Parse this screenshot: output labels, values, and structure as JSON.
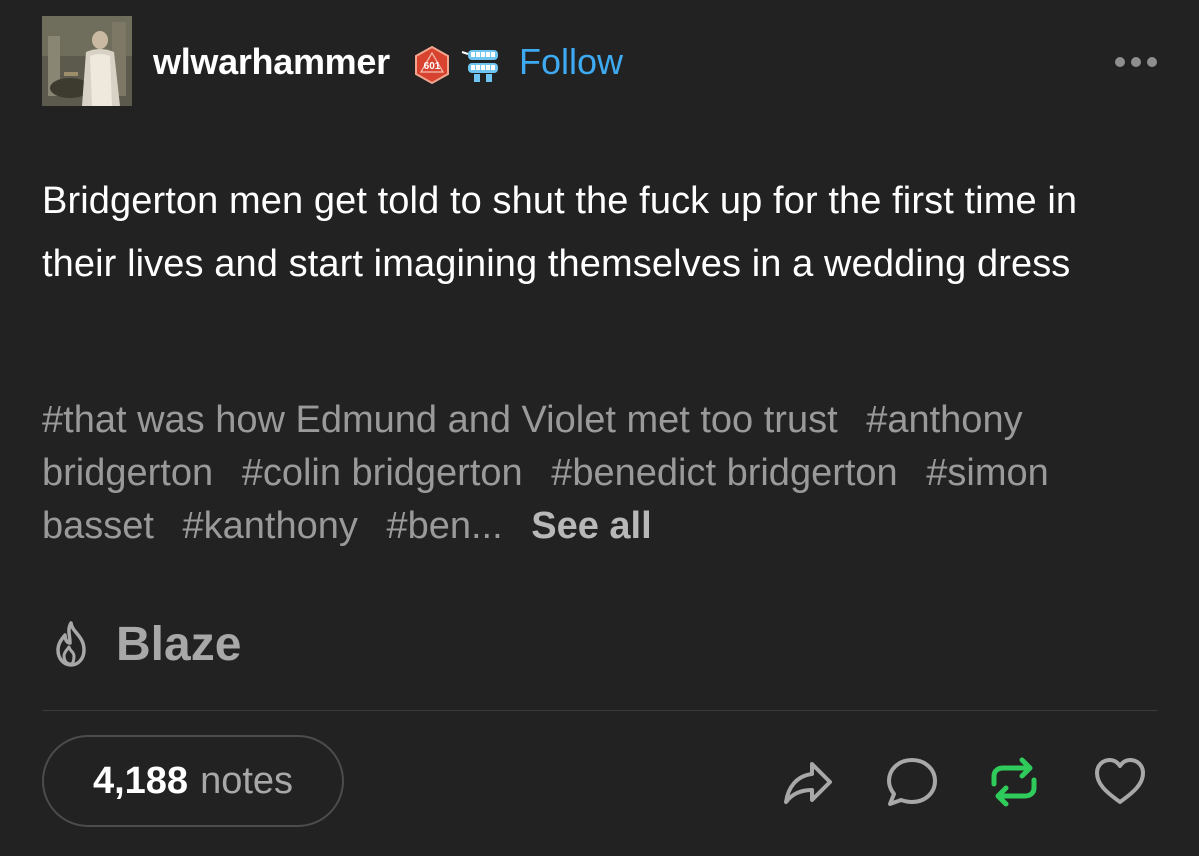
{
  "post": {
    "username": "wlwarhammer",
    "badge_d20_text": "601",
    "follow_label": "Follow",
    "body": "Bridgerton men get told to shut the fuck up for the first time in their lives and start imagining themselves in a wedding dress",
    "tags": [
      "#that was how Edmund and Violet met too trust",
      "#anthony bridgerton",
      "#colin bridgerton",
      "#benedict bridgerton",
      "#simon basset",
      "#kanthony",
      "#ben..."
    ],
    "see_all_label": "See all",
    "blaze_label": "Blaze",
    "notes_count": "4,188",
    "notes_label": "notes"
  },
  "icons": {
    "more": "more-dots-icon",
    "blaze": "flame-icon",
    "share": "share-arrow-icon",
    "reply": "reply-bubble-icon",
    "reblog": "reblog-icon",
    "like": "heart-icon"
  },
  "colors": {
    "background": "#222222",
    "follow": "#3eaaf2",
    "reblog_active": "#2fcc5b",
    "muted": "#9a9a9a"
  }
}
